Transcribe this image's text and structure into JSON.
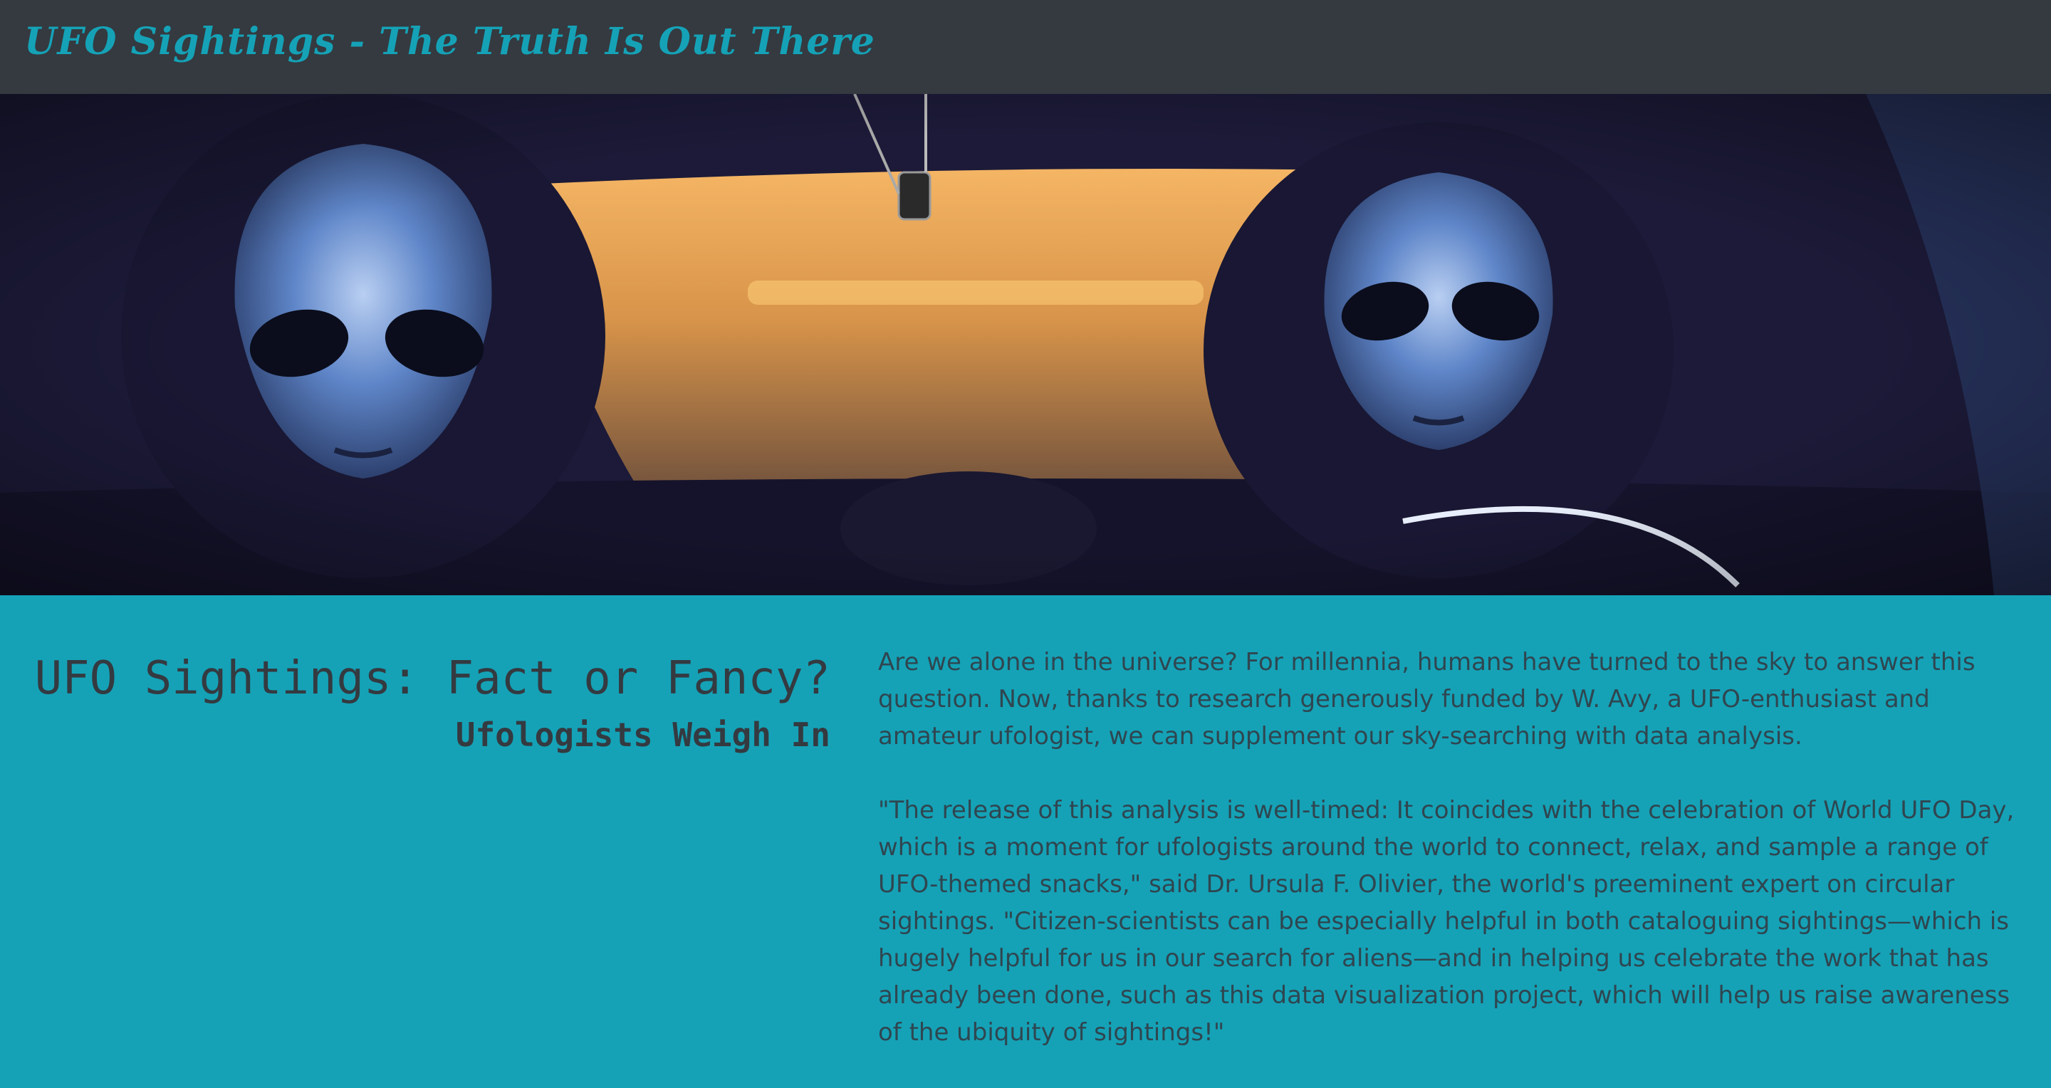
{
  "navbar": {
    "brand": "UFO Sightings - The Truth Is Out There"
  },
  "hero": {
    "image_description_icon": "alien-car-photo"
  },
  "main": {
    "title": "UFO Sightings: Fact or Fancy?",
    "subtitle": "Ufologists Weigh In",
    "paragraphs": [
      "Are we alone in the universe? For millennia, humans have turned to the sky to answer this question. Now, thanks to research generously funded by W. Avy, a UFO-enthusiast and amateur ufologist, we can supplement our sky-searching with data analysis.",
      "\"The release of this analysis is well-timed: It coincides with the celebration of World UFO Day, which is a moment for ufologists around the world to connect, relax, and sample a range of UFO-themed snacks,\" said Dr. Ursula F. Olivier, the world's preeminent expert on circular sightings. \"Citizen-scientists can be especially helpful in both cataloguing sightings—which is hugely helpful for us in our search for aliens—and in helping us celebrate the work that has already been done, such as this data visualization project, which will help us raise awareness of the ubiquity of sightings!\""
    ]
  },
  "colors": {
    "navbar_bg": "#343a40",
    "accent": "#15a2b7",
    "text_dark": "#343a40"
  }
}
